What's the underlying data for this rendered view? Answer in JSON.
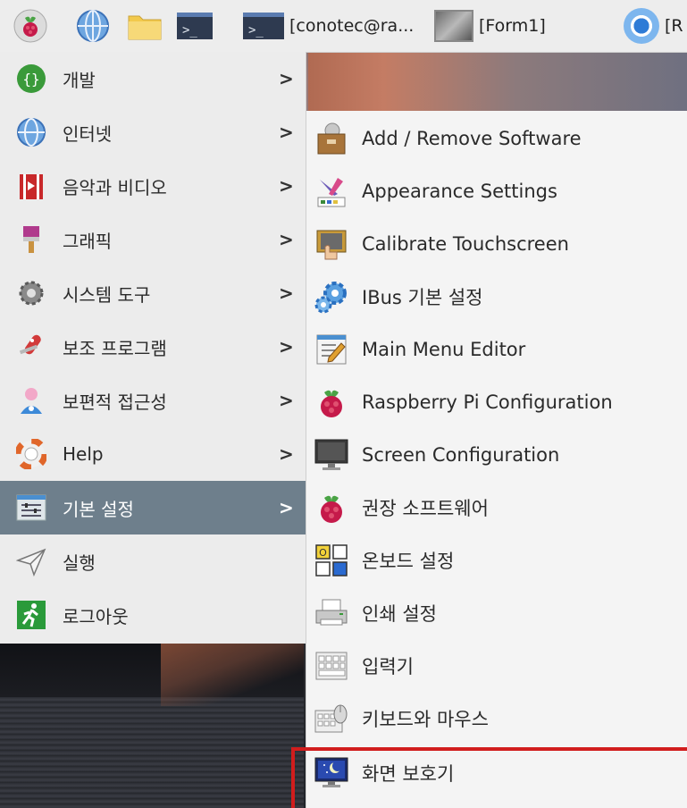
{
  "taskbar": {
    "icons": [
      "raspberry-icon",
      "globe-icon",
      "folder-icon",
      "terminal-icon"
    ],
    "tasks": [
      {
        "label": "[conotec@ra...",
        "icon": "terminal-icon"
      },
      {
        "label": "[Form1]",
        "icon": "form-window-icon"
      },
      {
        "label": "[R",
        "icon": "chromium-icon"
      }
    ]
  },
  "main_menu": {
    "items": [
      {
        "label": "개발",
        "icon": "programming-icon",
        "has_submenu": true
      },
      {
        "label": "인터넷",
        "icon": "internet-icon",
        "has_submenu": true
      },
      {
        "label": "음악과 비디오",
        "icon": "sound-video-icon",
        "has_submenu": true
      },
      {
        "label": "그래픽",
        "icon": "graphics-icon",
        "has_submenu": true
      },
      {
        "label": "시스템 도구",
        "icon": "system-tools-icon",
        "has_submenu": true
      },
      {
        "label": "보조 프로그램",
        "icon": "accessories-icon",
        "has_submenu": true
      },
      {
        "label": "보편적 접근성",
        "icon": "accessibility-icon",
        "has_submenu": true
      },
      {
        "label": "Help",
        "icon": "help-icon",
        "has_submenu": true
      },
      {
        "label": "기본 설정",
        "icon": "preferences-icon",
        "has_submenu": true,
        "selected": true
      },
      {
        "label": "실행",
        "icon": "run-icon",
        "has_submenu": false
      },
      {
        "label": "로그아웃",
        "icon": "logout-icon",
        "has_submenu": false
      }
    ],
    "arrow": ">"
  },
  "submenu": {
    "items": [
      {
        "label": "Add / Remove Software",
        "icon": "package-icon"
      },
      {
        "label": "Appearance Settings",
        "icon": "appearance-icon"
      },
      {
        "label": "Calibrate Touchscreen",
        "icon": "touchscreen-icon"
      },
      {
        "label": "IBus 기본 설정",
        "icon": "gear-icon"
      },
      {
        "label": "Main Menu Editor",
        "icon": "menu-editor-icon"
      },
      {
        "label": "Raspberry Pi Configuration",
        "icon": "raspberry-icon"
      },
      {
        "label": "Screen Configuration",
        "icon": "monitor-icon"
      },
      {
        "label": "권장 소프트웨어",
        "icon": "raspberry-icon"
      },
      {
        "label": "온보드 설정",
        "icon": "onboard-icon"
      },
      {
        "label": "인쇄 설정",
        "icon": "printer-icon"
      },
      {
        "label": "입력기",
        "icon": "keyboard-icon"
      },
      {
        "label": "키보드와 마우스",
        "icon": "keyboard-mouse-icon"
      },
      {
        "label": "화면 보호기",
        "icon": "screensaver-icon",
        "highlighted": true
      }
    ]
  },
  "colors": {
    "selected_bg": "#6e7f8c",
    "highlight_border": "#d11d1d",
    "menu_bg": "#ececec"
  }
}
